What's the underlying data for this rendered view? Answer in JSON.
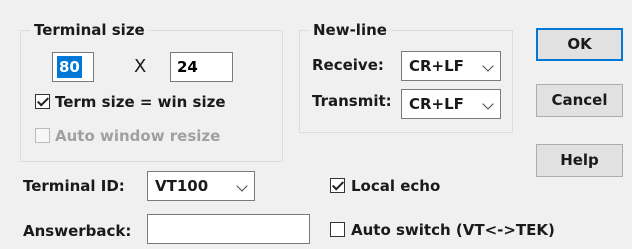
{
  "terminal_size": {
    "title": "Terminal size",
    "cols": "80",
    "times": "X",
    "rows": "24",
    "term_size_eq_win_size": {
      "label": "Term size = win size",
      "checked": true
    },
    "auto_window_resize": {
      "label": "Auto window resize",
      "checked": false,
      "disabled": true
    }
  },
  "new_line": {
    "title": "New-line",
    "receive_label": "Receive:",
    "receive_value": "CR+LF",
    "transmit_label": "Transmit:",
    "transmit_value": "CR+LF"
  },
  "buttons": {
    "ok": "OK",
    "cancel": "Cancel",
    "help": "Help"
  },
  "terminal_id": {
    "label": "Terminal ID:",
    "value": "VT100"
  },
  "answerback": {
    "label": "Answerback:",
    "value": ""
  },
  "local_echo": {
    "label": "Local echo",
    "checked": true
  },
  "auto_switch": {
    "label": "Auto switch (VT<->TEK)",
    "checked": false
  },
  "icons": {
    "dropdown": "chevron-down-icon",
    "check": "checkmark-icon"
  },
  "colors": {
    "focus": "#0078d7",
    "background": "#f0f0f0"
  }
}
